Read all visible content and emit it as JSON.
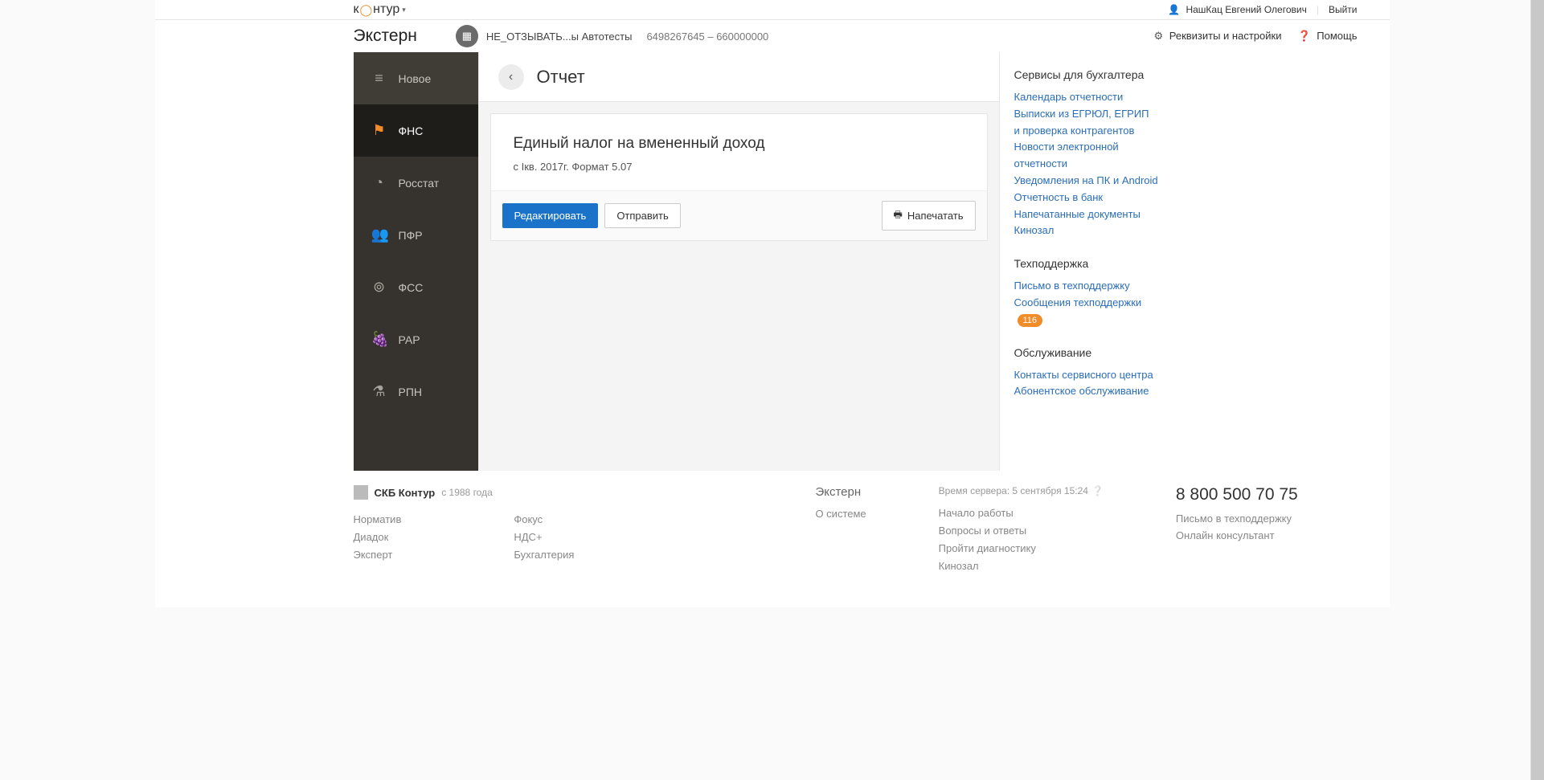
{
  "userbar": {
    "logo_left": "к",
    "logo_right": "нтур",
    "user_name": "НашКац Евгений Олегович",
    "logout": "Выйти"
  },
  "appheader": {
    "title": "Экстерн",
    "org_name": "НЕ_ОТЗЫВАТЬ...ы Автотесты",
    "org_codes": "6498267645 – 660000000",
    "settings": "Реквизиты и настройки",
    "help": "Помощь"
  },
  "sidebar": {
    "items": [
      {
        "label": "Новое",
        "icon": "≡"
      },
      {
        "label": "ФНС",
        "icon": "⚑"
      },
      {
        "label": "Росстат",
        "icon": "◔"
      },
      {
        "label": "ПФР",
        "icon": "👥"
      },
      {
        "label": "ФСС",
        "icon": "⊚"
      },
      {
        "label": "РАР",
        "icon": "🍇"
      },
      {
        "label": "РПН",
        "icon": "⚗"
      }
    ]
  },
  "content": {
    "page_title": "Отчет",
    "report_title": "Единый налог на вмененный доход",
    "report_sub": "с Iкв. 2017г. Формат 5.07",
    "edit_btn": "Редактировать",
    "send_btn": "Отправить",
    "print_btn": "Напечатать"
  },
  "rightcol": {
    "s1_title": "Сервисы для бухгалтера",
    "s1_links": [
      "Календарь отчетности",
      "Выписки из ЕГРЮЛ, ЕГРИП\nи проверка контрагентов",
      "Новости электронной отчетности",
      "Уведомления на ПК и Android",
      "Отчетность в банк",
      "Напечатанные документы",
      "Кинозал"
    ],
    "s2_title": "Техподдержка",
    "s2_link1": "Письмо в техподдержку",
    "s2_link2": "Сообщения техподдержки",
    "s2_badge": "116",
    "s3_title": "Обслуживание",
    "s3_links": [
      "Контакты сервисного центра",
      "Абонентское обслуживание"
    ]
  },
  "footer": {
    "skb_bold": "СКБ Контур",
    "skb_since": "с 1988 года",
    "col1": [
      "Норматив",
      "Диадок",
      "Эксперт"
    ],
    "col2": [
      "Фокус",
      "НДС+",
      "Бухгалтерия"
    ],
    "extern_head": "Экстерн",
    "extern_links": [
      "О системе"
    ],
    "server_time": "Время сервера: 5 сентября 15:24",
    "help_links": [
      "Начало работы",
      "Вопросы и ответы",
      "Пройти диагностику",
      "Кинозал"
    ],
    "phone": "8 800 500 70 75",
    "support_links": [
      "Письмо в техподдержку",
      "Онлайн консультант"
    ]
  }
}
